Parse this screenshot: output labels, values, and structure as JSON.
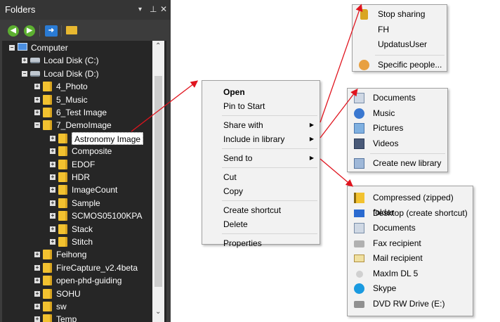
{
  "panel": {
    "title": "Folders",
    "header_buttons": {
      "dropdown": "▾",
      "pin": "⊥",
      "close": "✕"
    },
    "toolbar": {
      "back": "back-arrow",
      "forward": "forward-arrow",
      "sync": "sync-arrow",
      "new_folder": "folder-open"
    }
  },
  "tree": [
    {
      "label": "Computer",
      "icon": "computer-icon",
      "expander": "−",
      "level": 0
    },
    {
      "label": "Local Disk (C:)",
      "icon": "drive-icon",
      "expander": "+",
      "level": 1
    },
    {
      "label": "Local Disk (D:)",
      "icon": "drive-icon",
      "expander": "−",
      "level": 1
    },
    {
      "label": "4_Photo",
      "icon": "folder-icon",
      "expander": "+",
      "level": 2
    },
    {
      "label": "5_Music",
      "icon": "folder-icon",
      "expander": "+",
      "level": 2
    },
    {
      "label": "6_Test Image",
      "icon": "folder-icon",
      "expander": "+",
      "level": 2
    },
    {
      "label": "7_DemoImage",
      "icon": "folder-icon",
      "expander": "−",
      "level": 2
    },
    {
      "label": "Astronomy Image",
      "icon": "folder-icon",
      "expander": "+",
      "level": 3,
      "selected": true
    },
    {
      "label": "Composite",
      "icon": "folder-icon",
      "expander": "+",
      "level": 3
    },
    {
      "label": "EDOF",
      "icon": "folder-icon",
      "expander": "+",
      "level": 3
    },
    {
      "label": "HDR",
      "icon": "folder-icon",
      "expander": "+",
      "level": 3
    },
    {
      "label": "ImageCount",
      "icon": "folder-icon",
      "expander": "+",
      "level": 3
    },
    {
      "label": "Sample",
      "icon": "folder-icon",
      "expander": "+",
      "level": 3
    },
    {
      "label": "SCMOS05100KPA",
      "icon": "folder-icon",
      "expander": "+",
      "level": 3
    },
    {
      "label": "Stack",
      "icon": "folder-icon",
      "expander": "+",
      "level": 3
    },
    {
      "label": "Stitch",
      "icon": "folder-icon",
      "expander": "+",
      "level": 3
    },
    {
      "label": "Feihong",
      "icon": "folder-icon",
      "expander": "+",
      "level": 2
    },
    {
      "label": "FireCapture_v2.4beta",
      "icon": "folder-icon",
      "expander": "+",
      "level": 2
    },
    {
      "label": "open-phd-guiding",
      "icon": "folder-icon",
      "expander": "+",
      "level": 2
    },
    {
      "label": "SOHU",
      "icon": "folder-icon",
      "expander": "+",
      "level": 2
    },
    {
      "label": "sw",
      "icon": "folder-icon",
      "expander": "+",
      "level": 2
    },
    {
      "label": "Temp",
      "icon": "folder-icon",
      "expander": "+",
      "level": 2
    }
  ],
  "context_menu": {
    "items": [
      {
        "label": "Open",
        "bold": true
      },
      {
        "label": "Pin to Start"
      },
      {
        "sep": true
      },
      {
        "label": "Share with",
        "submenu": true
      },
      {
        "label": "Include in library",
        "submenu": true
      },
      {
        "sep": true
      },
      {
        "label": "Send to",
        "submenu": true
      },
      {
        "sep": true
      },
      {
        "label": "Cut"
      },
      {
        "label": "Copy"
      },
      {
        "sep": true
      },
      {
        "label": "Create shortcut"
      },
      {
        "label": "Delete"
      },
      {
        "sep": true
      },
      {
        "label": "Properties"
      }
    ]
  },
  "share_menu": {
    "items": [
      {
        "label": "Stop sharing",
        "icon": "lock-icon"
      },
      {
        "label": "FH",
        "icon": ""
      },
      {
        "label": "UpdatusUser",
        "icon": ""
      },
      {
        "sep": true
      },
      {
        "label": "Specific people...",
        "icon": "people-icon"
      }
    ]
  },
  "library_menu": {
    "items": [
      {
        "label": "Documents",
        "icon": "documents-library-icon"
      },
      {
        "label": "Music",
        "icon": "music-library-icon"
      },
      {
        "label": "Pictures",
        "icon": "pictures-library-icon"
      },
      {
        "label": "Videos",
        "icon": "videos-library-icon"
      },
      {
        "sep": true
      },
      {
        "label": "Create new library",
        "icon": "new-library-icon"
      }
    ]
  },
  "sendto_menu": {
    "items": [
      {
        "label": "Compressed (zipped) folder",
        "icon": "zip-folder-icon"
      },
      {
        "label": "Desktop (create shortcut)",
        "icon": "desktop-icon"
      },
      {
        "label": "Documents",
        "icon": "documents-icon"
      },
      {
        "label": "Fax recipient",
        "icon": "fax-icon"
      },
      {
        "label": "Mail recipient",
        "icon": "mail-icon"
      },
      {
        "label": "MaxIm DL 5",
        "icon": "maxim-icon"
      },
      {
        "label": "Skype",
        "icon": "skype-icon"
      },
      {
        "label": "DVD RW Drive (E:)",
        "icon": "dvd-drive-icon"
      }
    ]
  },
  "colors": {
    "arrow": "#e0141e",
    "panel_bg": "#262626",
    "menu_bg": "#f2f2f2",
    "icon_accent": "#2a7bd4"
  }
}
